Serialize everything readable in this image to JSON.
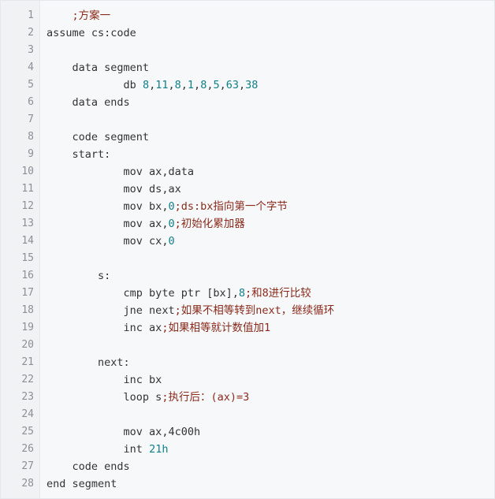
{
  "editor": {
    "language": "asm",
    "colors": {
      "background": "#f6f8fa",
      "gutter": "#f0f2f4",
      "line_number": "#8b9096",
      "text": "#333333",
      "number": "#0f7f86",
      "comment": "#8a2a1a"
    },
    "lines": [
      {
        "n": "1",
        "tokens": [
          {
            "t": "    ",
            "c": "sp"
          },
          {
            "t": ";方案一",
            "c": "cmt"
          }
        ]
      },
      {
        "n": "2",
        "tokens": [
          {
            "t": "assume cs:code",
            "c": "kw"
          }
        ]
      },
      {
        "n": "3",
        "tokens": []
      },
      {
        "n": "4",
        "tokens": [
          {
            "t": "    ",
            "c": "sp"
          },
          {
            "t": "data segment",
            "c": "kw"
          }
        ]
      },
      {
        "n": "5",
        "tokens": [
          {
            "t": "            ",
            "c": "sp"
          },
          {
            "t": "db ",
            "c": "kw"
          },
          {
            "t": "8",
            "c": "num"
          },
          {
            "t": ",",
            "c": "op"
          },
          {
            "t": "11",
            "c": "num"
          },
          {
            "t": ",",
            "c": "op"
          },
          {
            "t": "8",
            "c": "num"
          },
          {
            "t": ",",
            "c": "op"
          },
          {
            "t": "1",
            "c": "num"
          },
          {
            "t": ",",
            "c": "op"
          },
          {
            "t": "8",
            "c": "num"
          },
          {
            "t": ",",
            "c": "op"
          },
          {
            "t": "5",
            "c": "num"
          },
          {
            "t": ",",
            "c": "op"
          },
          {
            "t": "63",
            "c": "num"
          },
          {
            "t": ",",
            "c": "op"
          },
          {
            "t": "38",
            "c": "num"
          }
        ]
      },
      {
        "n": "6",
        "tokens": [
          {
            "t": "    ",
            "c": "sp"
          },
          {
            "t": "data ends",
            "c": "kw"
          }
        ]
      },
      {
        "n": "7",
        "tokens": []
      },
      {
        "n": "8",
        "tokens": [
          {
            "t": "    ",
            "c": "sp"
          },
          {
            "t": "code segment",
            "c": "kw"
          }
        ]
      },
      {
        "n": "9",
        "tokens": [
          {
            "t": "    ",
            "c": "sp"
          },
          {
            "t": "start:",
            "c": "kw"
          }
        ]
      },
      {
        "n": "10",
        "tokens": [
          {
            "t": "            ",
            "c": "sp"
          },
          {
            "t": "mov ax,data",
            "c": "kw"
          }
        ]
      },
      {
        "n": "11",
        "tokens": [
          {
            "t": "            ",
            "c": "sp"
          },
          {
            "t": "mov ds,ax",
            "c": "kw"
          }
        ]
      },
      {
        "n": "12",
        "tokens": [
          {
            "t": "            ",
            "c": "sp"
          },
          {
            "t": "mov bx,",
            "c": "kw"
          },
          {
            "t": "0",
            "c": "num"
          },
          {
            "t": ";ds:bx指向第一个字节",
            "c": "cmt"
          }
        ]
      },
      {
        "n": "13",
        "tokens": [
          {
            "t": "            ",
            "c": "sp"
          },
          {
            "t": "mov ax,",
            "c": "kw"
          },
          {
            "t": "0",
            "c": "num"
          },
          {
            "t": ";初始化累加器",
            "c": "cmt"
          }
        ]
      },
      {
        "n": "14",
        "tokens": [
          {
            "t": "            ",
            "c": "sp"
          },
          {
            "t": "mov cx,",
            "c": "kw"
          },
          {
            "t": "0",
            "c": "num"
          }
        ]
      },
      {
        "n": "15",
        "tokens": []
      },
      {
        "n": "16",
        "tokens": [
          {
            "t": "        ",
            "c": "sp"
          },
          {
            "t": "s:",
            "c": "kw"
          }
        ]
      },
      {
        "n": "17",
        "tokens": [
          {
            "t": "            ",
            "c": "sp"
          },
          {
            "t": "cmp byte ptr [bx],",
            "c": "kw"
          },
          {
            "t": "8",
            "c": "num"
          },
          {
            "t": ";和8进行比较",
            "c": "cmt"
          }
        ]
      },
      {
        "n": "18",
        "tokens": [
          {
            "t": "            ",
            "c": "sp"
          },
          {
            "t": "jne next",
            "c": "kw"
          },
          {
            "t": ";如果不相等转到next，继续循环",
            "c": "cmt"
          }
        ]
      },
      {
        "n": "19",
        "tokens": [
          {
            "t": "            ",
            "c": "sp"
          },
          {
            "t": "inc ax",
            "c": "kw"
          },
          {
            "t": ";如果相等就计数值加1",
            "c": "cmt"
          }
        ]
      },
      {
        "n": "20",
        "tokens": []
      },
      {
        "n": "21",
        "tokens": [
          {
            "t": "        ",
            "c": "sp"
          },
          {
            "t": "next:",
            "c": "kw"
          }
        ]
      },
      {
        "n": "22",
        "tokens": [
          {
            "t": "            ",
            "c": "sp"
          },
          {
            "t": "inc bx",
            "c": "kw"
          }
        ]
      },
      {
        "n": "23",
        "tokens": [
          {
            "t": "            ",
            "c": "sp"
          },
          {
            "t": "loop s",
            "c": "kw"
          },
          {
            "t": ";执行后：(ax)=3",
            "c": "cmt"
          }
        ]
      },
      {
        "n": "24",
        "tokens": []
      },
      {
        "n": "25",
        "tokens": [
          {
            "t": "            ",
            "c": "sp"
          },
          {
            "t": "mov ax,4c00h",
            "c": "kw"
          }
        ]
      },
      {
        "n": "26",
        "tokens": [
          {
            "t": "            ",
            "c": "sp"
          },
          {
            "t": "int ",
            "c": "kw"
          },
          {
            "t": "21h",
            "c": "num"
          }
        ]
      },
      {
        "n": "27",
        "tokens": [
          {
            "t": "    ",
            "c": "sp"
          },
          {
            "t": "code ends",
            "c": "kw"
          }
        ]
      },
      {
        "n": "28",
        "tokens": [
          {
            "t": "end segment",
            "c": "kw"
          }
        ]
      }
    ]
  }
}
